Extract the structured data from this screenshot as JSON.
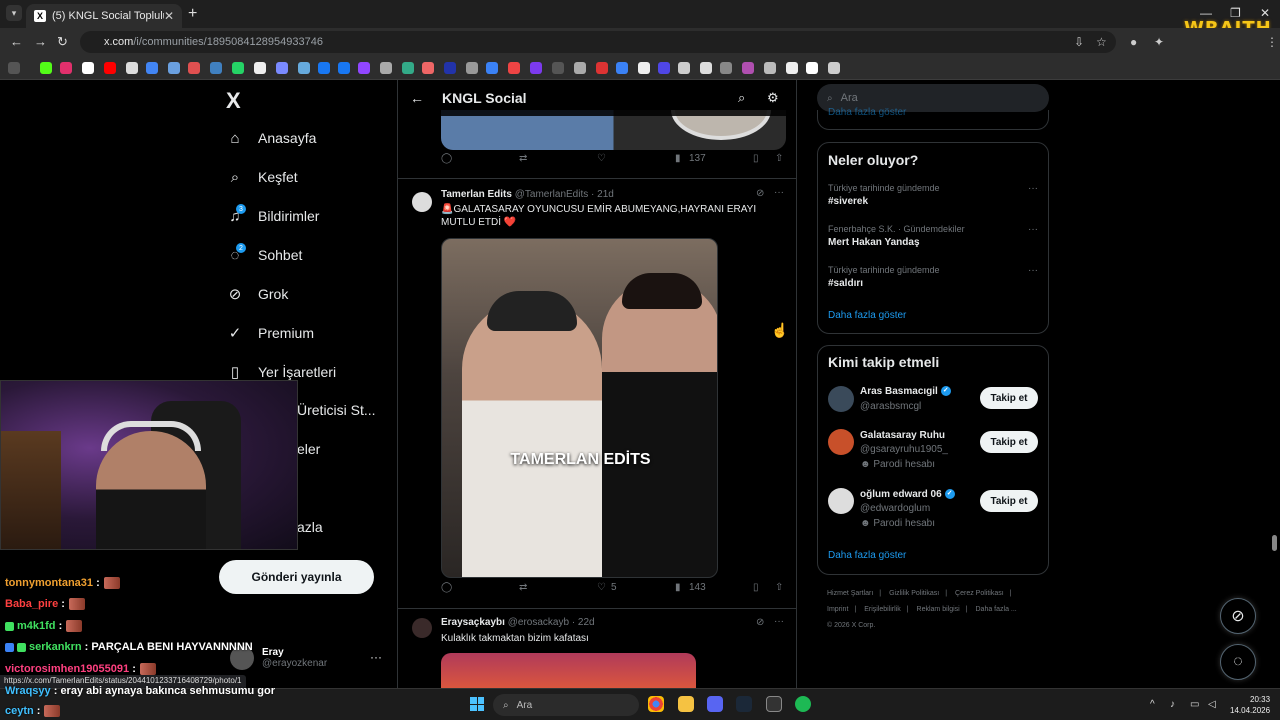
{
  "browser": {
    "tab_title": "(5) KNGL Social Topluluk / X",
    "url_host": "x.com",
    "url_path": "/i/communities/1895084128954933746",
    "overlay_logo": "WRAITH",
    "status_url": "https://x.com/TamerlanEdits/status/2044101233716408729/photo/1"
  },
  "sidebar": {
    "logo": "X",
    "items": [
      {
        "label": "Anasayfa",
        "icon": "home-icon"
      },
      {
        "label": "Keşfet",
        "icon": "search-icon"
      },
      {
        "label": "Bildirimler",
        "icon": "bell-icon",
        "badge": "3"
      },
      {
        "label": "Sohbet",
        "icon": "chat-icon",
        "badge": "2"
      },
      {
        "label": "Grok",
        "icon": "grok-icon"
      },
      {
        "label": "Premium",
        "icon": "premium-icon"
      },
      {
        "label": "Yer İşaretleri",
        "icon": "bookmark-icon"
      },
      {
        "label": "Üreticisi St...",
        "icon": "creator-icon"
      },
      {
        "label": "eler",
        "icon": "list-icon"
      },
      {
        "label": "azla",
        "icon": "more-icon"
      }
    ],
    "post_button": "Gönderi yayınla",
    "account": {
      "name": "Eray",
      "handle": "@erayozkenar"
    }
  },
  "center": {
    "title": "KNGL Social",
    "prev_actions": {
      "views": "137"
    },
    "tweet": {
      "author": "Tamerlan Edits",
      "handle": "@TamerlanEdits",
      "time": "· 21d",
      "text": "🚨GALATASARAY OYUNCUSU EMİR ABUMEYANG,HAYRANI ERAYI MUTLU ETDİ ❤️",
      "media_caption": "TAMERLAN EDİTS",
      "likes": "5",
      "views": "143"
    },
    "tweet2": {
      "author": "Eraysaçkaybı",
      "handle": "@erosackayb",
      "time": "· 22d",
      "text": "Kulaklık takmaktan bizim kafatası"
    }
  },
  "right": {
    "search_placeholder": "Ara",
    "top_show_more": "Daha fazla göster",
    "trends_title": "Neler oluyor?",
    "trends": [
      {
        "meta": "Türkiye tarihinde gündemde",
        "name": "#siverek"
      },
      {
        "meta": "Fenerbahçe S.K. · Gündemdekiler",
        "name": "Mert Hakan Yandaş"
      },
      {
        "meta": "Türkiye tarihinde gündemde",
        "name": "#saldırı"
      }
    ],
    "trends_show_more": "Daha fazla göster",
    "wtf_title": "Kimi takip etmeli",
    "who_to_follow": [
      {
        "name": "Aras Basmacıgil",
        "handle": "@arasbsmcgl",
        "verified": true,
        "parody": "",
        "button": "Takip et"
      },
      {
        "name": "Galatasaray Ruhu",
        "handle": "@gsarayruhu1905_",
        "verified": false,
        "parody": "Parodi hesabı",
        "button": "Takip et"
      },
      {
        "name": "oğlum edward 06",
        "handle": "@edwardoglum",
        "verified": true,
        "parody": "Parodi hesabı",
        "button": "Takip et"
      }
    ],
    "wtf_show_more": "Daha fazla göster",
    "footer": [
      "Hizmet Şartları",
      "Gizlilik Politikası",
      "Çerez Politikası",
      "Imprint",
      "Erişilebilirlik",
      "Reklam bilgisi",
      "Daha fazla ...",
      "© 2026 X Corp."
    ]
  },
  "chat": [
    {
      "user": "tonnymontana31",
      "msg": "",
      "color": "#f0a030"
    },
    {
      "user": "Baba_pire",
      "msg": "",
      "color": "#ff4040"
    },
    {
      "user": "m4k1fd",
      "msg": "",
      "color": "#40e060"
    },
    {
      "user": "serkankrn",
      "msg": "PARÇALA BENI HAYVANNNNN",
      "color": "#40e060"
    },
    {
      "user": "victorosimhen19055091",
      "msg": "",
      "color": "#ff4080"
    },
    {
      "user": "Wraqsyy",
      "msg": "eray abi aynaya bakınca sehmusumu gor",
      "color": "#40c0ff"
    },
    {
      "user": "ceytn",
      "msg": "",
      "color": "#40c0ff"
    }
  ],
  "taskbar": {
    "search_placeholder": "Ara",
    "time": "20:33",
    "date": "14.04.2026"
  },
  "colors": {
    "accent": "#1d9bf0",
    "background": "#000000",
    "border": "#2f3336"
  }
}
